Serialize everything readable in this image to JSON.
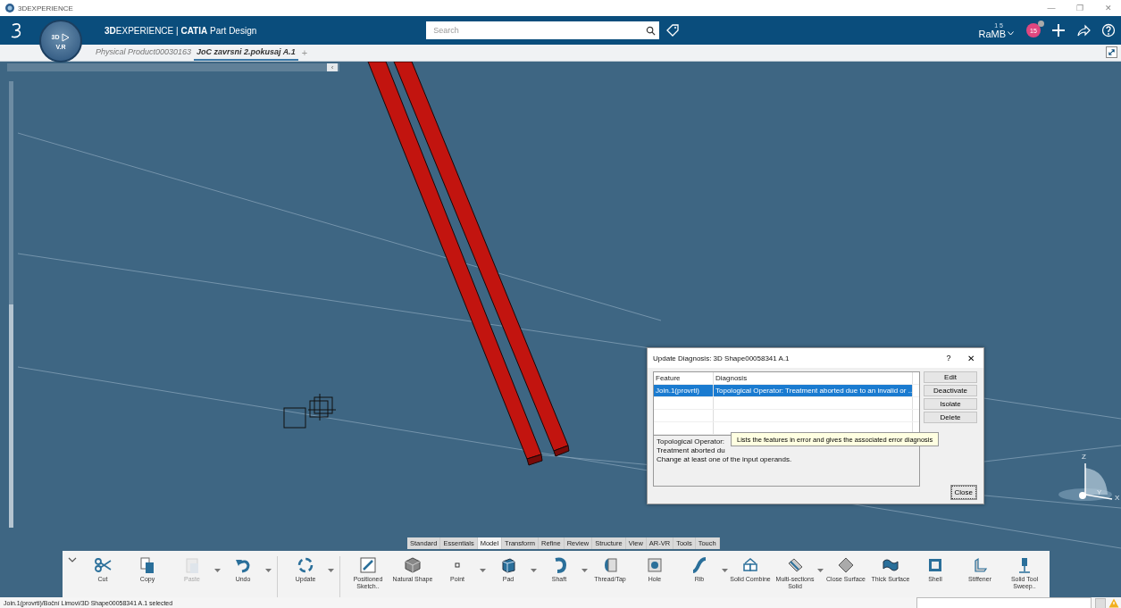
{
  "window": {
    "title": "3DEXPERIENCE",
    "controls": [
      "—",
      "❐",
      "✕"
    ]
  },
  "header": {
    "brand": "**3D**EXPERIENCE | **CATIA** Part Design",
    "compass_labels": [
      "3D",
      "V.R"
    ],
    "search": {
      "placeholder": "Search"
    },
    "user": {
      "scale": "1 5",
      "name": "RaMB"
    },
    "notifications": "15"
  },
  "doc_tabs": {
    "tabs": [
      {
        "label": "Physical Product00030163",
        "selected": false
      },
      {
        "label": "JoC zavrsni 2.pokusaj A.1",
        "selected": true
      }
    ],
    "add": "+"
  },
  "viewport": {
    "panel_toggle": "‹",
    "axes": [
      "Z",
      "Y",
      "X"
    ]
  },
  "dialog": {
    "title": "Update Diagnosis: 3D Shape00058341 A.1",
    "help": "?",
    "close_glyph": "✕",
    "columns": [
      "Feature",
      "Diagnosis"
    ],
    "rows": [
      {
        "feature": "Join.1(provrti)",
        "diagnosis": "Topological Operator: Treatment aborted due to an invalid or ...",
        "selected": true
      }
    ],
    "buttons": [
      "Edit",
      "Deactivate",
      "Isolate",
      "Delete"
    ],
    "message": [
      "Topological Operator:",
      "Treatment aborted du",
      "Change at least one of the input operands."
    ],
    "close_button": "Close"
  },
  "tooltip": "Lists the features in error and gives the associated error diagnosis",
  "toolbar": {
    "sections": [
      {
        "label": "Standard",
        "selected": false
      },
      {
        "label": "Essentials",
        "selected": false
      },
      {
        "label": "Model",
        "selected": true
      },
      {
        "label": "Transform",
        "selected": false
      },
      {
        "label": "Refine",
        "selected": false
      },
      {
        "label": "Review",
        "selected": false
      },
      {
        "label": "Structure",
        "selected": false
      },
      {
        "label": "View",
        "selected": false
      },
      {
        "label": "AR-VR",
        "selected": false
      },
      {
        "label": "Tools",
        "selected": false
      },
      {
        "label": "Touch",
        "selected": false
      }
    ],
    "tools": [
      {
        "kind": "tool",
        "label": "Cut",
        "dropdown": false,
        "disabled": false
      },
      {
        "kind": "tool",
        "label": "Copy",
        "dropdown": false,
        "disabled": false
      },
      {
        "kind": "tool",
        "label": "Paste",
        "dropdown": true,
        "disabled": true
      },
      {
        "kind": "tool",
        "label": "Undo",
        "dropdown": true,
        "disabled": false
      },
      {
        "kind": "separator"
      },
      {
        "kind": "tool",
        "label": "Update",
        "dropdown": true,
        "disabled": false
      },
      {
        "kind": "separator"
      },
      {
        "kind": "tool",
        "label": "Positioned Sketch..",
        "dropdown": false,
        "disabled": false
      },
      {
        "kind": "tool",
        "label": "Natural Shape",
        "dropdown": false,
        "disabled": false
      },
      {
        "kind": "tool",
        "label": "Point",
        "dropdown": true,
        "disabled": false
      },
      {
        "kind": "tool",
        "label": "Pad",
        "dropdown": true,
        "disabled": false
      },
      {
        "kind": "tool",
        "label": "Shaft",
        "dropdown": true,
        "disabled": false
      },
      {
        "kind": "tool",
        "label": "Thread/Tap",
        "dropdown": false,
        "disabled": false
      },
      {
        "kind": "tool",
        "label": "Hole",
        "dropdown": false,
        "disabled": false
      },
      {
        "kind": "tool",
        "label": "Rib",
        "dropdown": true,
        "disabled": false
      },
      {
        "kind": "tool",
        "label": "Solid Combine",
        "dropdown": false,
        "disabled": false
      },
      {
        "kind": "tool",
        "label": "Multi-sections Solid",
        "dropdown": true,
        "disabled": false
      },
      {
        "kind": "tool",
        "label": "Close Surface",
        "dropdown": false,
        "disabled": false
      },
      {
        "kind": "tool",
        "label": "Thick Surface",
        "dropdown": false,
        "disabled": false
      },
      {
        "kind": "tool",
        "label": "Shell",
        "dropdown": false,
        "disabled": false
      },
      {
        "kind": "tool",
        "label": "Stiffener",
        "dropdown": false,
        "disabled": false
      },
      {
        "kind": "tool",
        "label": "Solid Tool Sweep..",
        "dropdown": false,
        "disabled": false
      }
    ]
  },
  "status_bar": {
    "text": "Join.1(provrti)/Boční Limovi/3D Shape00058341 A.1 selected"
  }
}
